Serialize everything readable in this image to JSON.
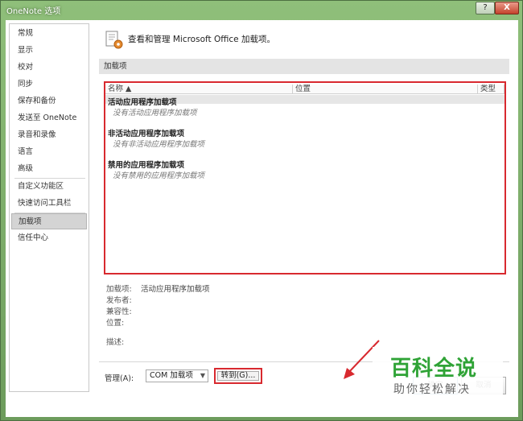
{
  "window": {
    "title": "OneNote 选项",
    "help_label": "?",
    "close_label": "X"
  },
  "sidebar": {
    "items": [
      {
        "label": "常规"
      },
      {
        "label": "显示"
      },
      {
        "label": "校对"
      },
      {
        "label": "同步"
      },
      {
        "label": "保存和备份"
      },
      {
        "label": "发送至 OneNote"
      },
      {
        "label": "录音和录像"
      },
      {
        "label": "语言"
      },
      {
        "label": "高级"
      },
      {
        "label": "自定义功能区"
      },
      {
        "label": "快速访问工具栏"
      },
      {
        "label": "加载项",
        "selected": true
      },
      {
        "label": "信任中心"
      }
    ]
  },
  "header": {
    "text": "查看和管理 Microsoft Office 加载项。"
  },
  "section": {
    "title": "加载项"
  },
  "addins_table": {
    "columns": [
      "名称 ▲",
      "位置",
      "类型"
    ],
    "groups": [
      {
        "title": "活动应用程序加载项",
        "empty": "没有活动应用程序加载项"
      },
      {
        "title": "非活动应用程序加载项",
        "empty": "没有非活动应用程序加载项"
      },
      {
        "title": "禁用的应用程序加载项",
        "empty": "没有禁用的应用程序加载项"
      }
    ]
  },
  "details": {
    "addin_label": "加载项:",
    "addin_value": "活动应用程序加载项",
    "publisher_label": "发布者:",
    "compat_label": "兼容性:",
    "location_label": "位置:",
    "desc_label": "描述:"
  },
  "manage": {
    "label": "管理(A):",
    "selected": "COM 加载项",
    "arrow": "▼",
    "goto_label": "转到(G)..."
  },
  "footer": {
    "ok_label": "确定",
    "cancel_label": "取消"
  },
  "watermark": {
    "main": "百科全说",
    "sub": "助你轻松解决"
  },
  "colors": {
    "highlight_red": "#d8292f",
    "title_green": "#7fae6e",
    "watermark_green": "#2fa336"
  }
}
